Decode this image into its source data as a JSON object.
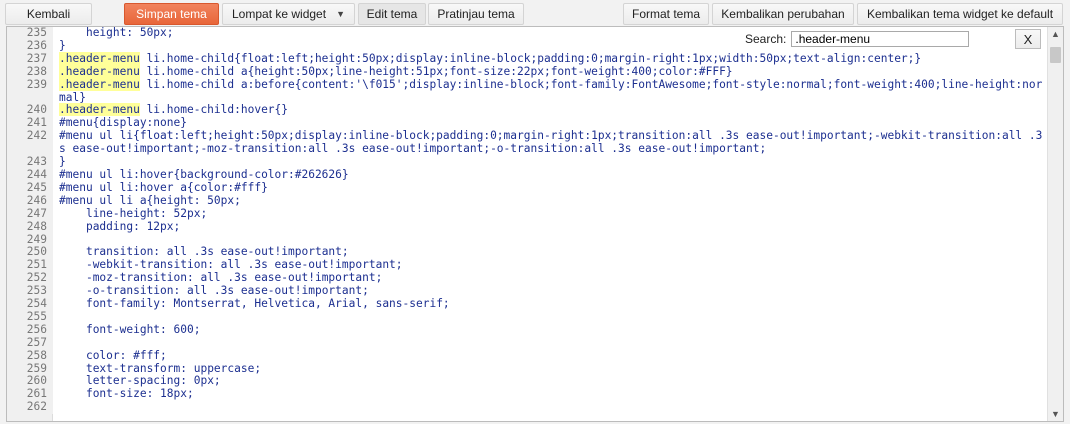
{
  "toolbar": {
    "back": "Kembali",
    "save": "Simpan tema",
    "jump": "Lompat ke widget",
    "edit": "Edit tema",
    "preview": "Pratinjau tema",
    "format": "Format tema",
    "revert": "Kembalikan perubahan",
    "revert_default": "Kembalikan tema widget ke default"
  },
  "search": {
    "label": "Search:",
    "value": ".header-menu",
    "close": "X"
  },
  "highlight_term": ".header-menu",
  "lines": [
    {
      "n": "235",
      "text": "    height: 50px;"
    },
    {
      "n": "236",
      "text": "}"
    },
    {
      "n": "237",
      "text": ".header-menu li.home-child{float:left;height:50px;display:inline-block;padding:0;margin-right:1px;width:50px;text-align:center;}"
    },
    {
      "n": "238",
      "text": ".header-menu li.home-child a{height:50px;line-height:51px;font-size:22px;font-weight:400;color:#FFF}"
    },
    {
      "n": "239",
      "text": ".header-menu li.home-child a:before{content:'\\f015';display:inline-block;font-family:FontAwesome;font-style:normal;font-weight:400;line-height:normal}"
    },
    {
      "n": "240",
      "text": ".header-menu li.home-child:hover{}"
    },
    {
      "n": "241",
      "text": "#menu{display:none}"
    },
    {
      "n": "242",
      "text": "#menu ul li{float:left;height:50px;display:inline-block;padding:0;margin-right:1px;transition:all .3s ease-out!important;-webkit-transition:all .3s ease-out!important;-moz-transition:all .3s ease-out!important;-o-transition:all .3s ease-out!important;"
    },
    {
      "n": "243",
      "text": "}"
    },
    {
      "n": "244",
      "text": "#menu ul li:hover{background-color:#262626}"
    },
    {
      "n": "245",
      "text": "#menu ul li:hover a{color:#fff}"
    },
    {
      "n": "246",
      "text": "#menu ul li a{height: 50px;"
    },
    {
      "n": "247",
      "text": "    line-height: 52px;"
    },
    {
      "n": "248",
      "text": "    padding: 12px;"
    },
    {
      "n": "249",
      "text": ""
    },
    {
      "n": "250",
      "text": "    transition: all .3s ease-out!important;"
    },
    {
      "n": "251",
      "text": "    -webkit-transition: all .3s ease-out!important;"
    },
    {
      "n": "252",
      "text": "    -moz-transition: all .3s ease-out!important;"
    },
    {
      "n": "253",
      "text": "    -o-transition: all .3s ease-out!important;"
    },
    {
      "n": "254",
      "text": "    font-family: Montserrat, Helvetica, Arial, sans-serif;"
    },
    {
      "n": "255",
      "text": ""
    },
    {
      "n": "256",
      "text": "    font-weight: 600;"
    },
    {
      "n": "257",
      "text": ""
    },
    {
      "n": "258",
      "text": "    color: #fff;"
    },
    {
      "n": "259",
      "text": "    text-transform: uppercase;"
    },
    {
      "n": "260",
      "text": "    letter-spacing: 0px;"
    },
    {
      "n": "261",
      "text": "    font-size: 18px;"
    },
    {
      "n": "262",
      "text": ""
    }
  ]
}
